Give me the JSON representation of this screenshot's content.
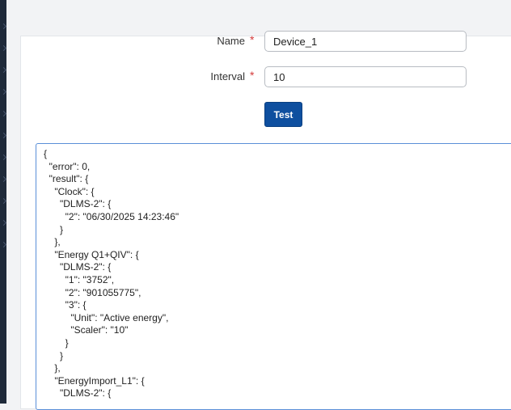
{
  "form": {
    "name": {
      "label": "Name",
      "required_mark": "*",
      "value": "Device_1"
    },
    "interval": {
      "label": "Interval",
      "required_mark": "*",
      "value": "10"
    },
    "test_button_label": "Test"
  },
  "result": {
    "text": "{\n  \"error\": 0,\n  \"result\": {\n    \"Clock\": {\n      \"DLMS-2\": {\n        \"2\": \"06/30/2025 14:23:46\"\n      }\n    },\n    \"Energy Q1+QIV\": {\n      \"DLMS-2\": {\n        \"1\": \"3752\",\n        \"2\": \"901055775\",\n        \"3\": {\n          \"Unit\": \"Active energy\",\n          \"Scaler\": \"10\"\n        }\n      }\n    },\n    \"EnergyImport_L1\": {\n      \"DLMS-2\": {"
  }
}
